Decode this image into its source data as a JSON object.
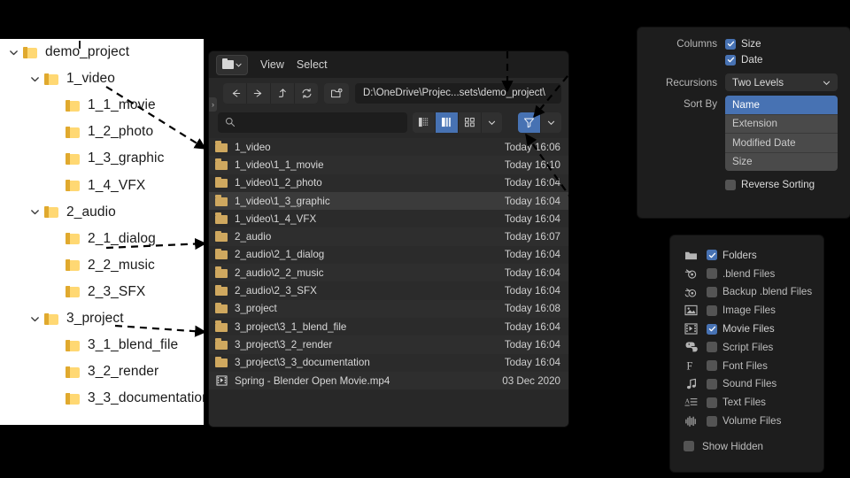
{
  "explorer": {
    "tree": [
      {
        "label": "demo_project",
        "depth": 0,
        "expanded": true,
        "chevron": "chevron-down-icon"
      },
      {
        "label": "1_video",
        "depth": 1,
        "expanded": true,
        "chevron": "chevron-down-icon"
      },
      {
        "label": "1_1_movie",
        "depth": 2,
        "expanded": false,
        "chevron": ""
      },
      {
        "label": "1_2_photo",
        "depth": 2,
        "expanded": false,
        "chevron": ""
      },
      {
        "label": "1_3_graphic",
        "depth": 2,
        "expanded": false,
        "chevron": ""
      },
      {
        "label": "1_4_VFX",
        "depth": 2,
        "expanded": false,
        "chevron": ""
      },
      {
        "label": "2_audio",
        "depth": 1,
        "expanded": true,
        "chevron": "chevron-down-icon"
      },
      {
        "label": "2_1_dialog",
        "depth": 2,
        "expanded": false,
        "chevron": ""
      },
      {
        "label": "2_2_music",
        "depth": 2,
        "expanded": false,
        "chevron": ""
      },
      {
        "label": "2_3_SFX",
        "depth": 2,
        "expanded": false,
        "chevron": ""
      },
      {
        "label": "3_project",
        "depth": 1,
        "expanded": true,
        "chevron": "chevron-down-icon"
      },
      {
        "label": "3_1_blend_file",
        "depth": 2,
        "expanded": false,
        "chevron": ""
      },
      {
        "label": "3_2_render",
        "depth": 2,
        "expanded": false,
        "chevron": ""
      },
      {
        "label": "3_3_documentation",
        "depth": 2,
        "expanded": false,
        "chevron": ""
      }
    ]
  },
  "blender": {
    "header": {
      "editor_type_icon": "file-browser-icon",
      "menus": [
        "View",
        "Select"
      ]
    },
    "nav": {
      "back_icon": "arrow-left-icon",
      "forward_icon": "arrow-right-icon",
      "up_icon": "arrow-up-parent-icon",
      "refresh_icon": "refresh-icon",
      "new_folder_icon": "new-folder-icon",
      "path_value": "D:\\OneDrive\\Projec...sets\\demo_project\\"
    },
    "search": {
      "icon": "search-icon",
      "value": "",
      "placeholder": ""
    },
    "display_modes": [
      {
        "name": "vertical-list",
        "active": false
      },
      {
        "name": "horizontal-list",
        "active": true
      },
      {
        "name": "thumbnails",
        "active": false
      }
    ],
    "display_chevron": "chevron-down-icon",
    "filter_toggle": {
      "icon": "funnel-icon",
      "active": true
    },
    "filter_chevron": "chevron-down-icon",
    "columns": [
      "Name",
      "Date"
    ],
    "files": [
      {
        "name": "1_video",
        "date": "Today 16:06",
        "type": "folder",
        "selected": false
      },
      {
        "name": "1_video\\1_1_movie",
        "date": "Today 16:10",
        "type": "folder",
        "selected": false
      },
      {
        "name": "1_video\\1_2_photo",
        "date": "Today 16:04",
        "type": "folder",
        "selected": false
      },
      {
        "name": "1_video\\1_3_graphic",
        "date": "Today 16:04",
        "type": "folder",
        "selected": true
      },
      {
        "name": "1_video\\1_4_VFX",
        "date": "Today 16:04",
        "type": "folder",
        "selected": false
      },
      {
        "name": "2_audio",
        "date": "Today 16:07",
        "type": "folder",
        "selected": false
      },
      {
        "name": "2_audio\\2_1_dialog",
        "date": "Today 16:04",
        "type": "folder",
        "selected": false
      },
      {
        "name": "2_audio\\2_2_music",
        "date": "Today 16:04",
        "type": "folder",
        "selected": false
      },
      {
        "name": "2_audio\\2_3_SFX",
        "date": "Today 16:04",
        "type": "folder",
        "selected": false
      },
      {
        "name": "3_project",
        "date": "Today 16:08",
        "type": "folder",
        "selected": false
      },
      {
        "name": "3_project\\3_1_blend_file",
        "date": "Today 16:04",
        "type": "folder",
        "selected": false
      },
      {
        "name": "3_project\\3_2_render",
        "date": "Today 16:04",
        "type": "folder",
        "selected": false
      },
      {
        "name": "3_project\\3_3_documentation",
        "date": "Today 16:04",
        "type": "folder",
        "selected": false
      },
      {
        "name": "Spring - Blender Open Movie.mp4",
        "date": "03 Dec 2020",
        "type": "movie",
        "selected": false
      }
    ]
  },
  "options_panel": {
    "columns_label": "Columns",
    "columns": [
      {
        "label": "Size",
        "checked": true
      },
      {
        "label": "Date",
        "checked": true
      }
    ],
    "recursions_label": "Recursions",
    "recursions_value": "Two Levels",
    "recursions_chevron": "chevron-down-icon",
    "sort_by_label": "Sort By",
    "sort_options": [
      {
        "label": "Name",
        "active": true
      },
      {
        "label": "Extension",
        "active": false
      },
      {
        "label": "Modified Date",
        "active": false
      },
      {
        "label": "Size",
        "active": false
      }
    ],
    "reverse_sorting": {
      "label": "Reverse Sorting",
      "checked": false
    }
  },
  "filter_panel": {
    "items": [
      {
        "label": "Folders",
        "checked": true,
        "icon": "folder-icon"
      },
      {
        "label": ".blend Files",
        "checked": false,
        "icon": "blender-file-icon"
      },
      {
        "label": "Backup .blend Files",
        "checked": false,
        "icon": "blender-backup-icon"
      },
      {
        "label": "Image Files",
        "checked": false,
        "icon": "image-icon"
      },
      {
        "label": "Movie Files",
        "checked": true,
        "icon": "film-strip-icon"
      },
      {
        "label": "Script Files",
        "checked": false,
        "icon": "python-icon"
      },
      {
        "label": "Font Files",
        "checked": false,
        "icon": "font-icon"
      },
      {
        "label": "Sound Files",
        "checked": false,
        "icon": "music-note-icon"
      },
      {
        "label": "Text Files",
        "checked": false,
        "icon": "text-file-icon"
      },
      {
        "label": "Volume Files",
        "checked": false,
        "icon": "volume-icon"
      }
    ],
    "show_hidden": {
      "label": "Show Hidden",
      "checked": false
    }
  },
  "colors": {
    "accent_blue": "#4772b3",
    "folder_yellow": "#ffd873",
    "blender_folder": "#cfa85f",
    "panel_bg": "#1d1d1d",
    "list_bg": "#282828"
  }
}
